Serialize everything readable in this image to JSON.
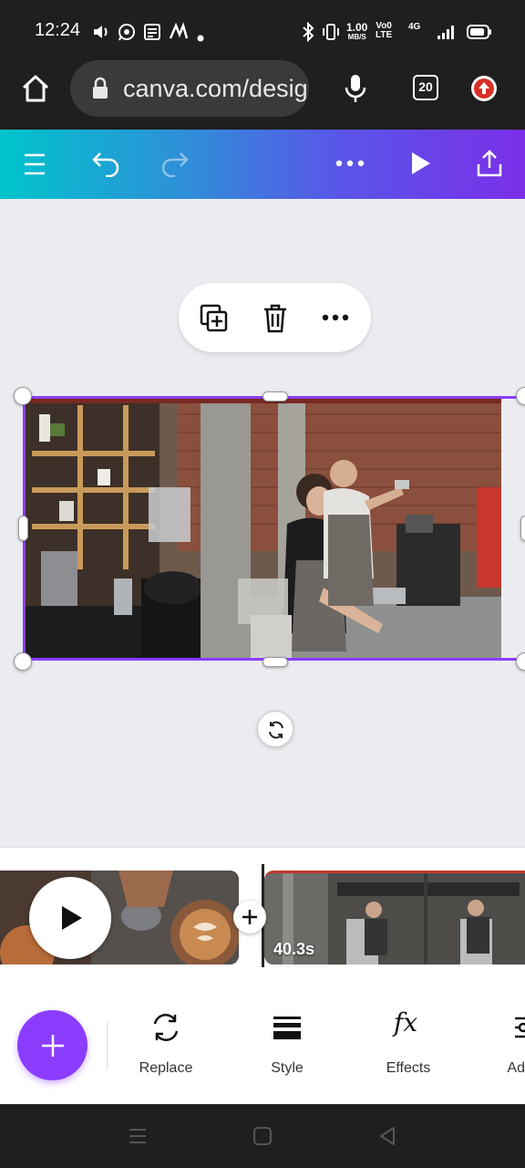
{
  "status_bar": {
    "time": "12:24",
    "net_speed_value": "1.00",
    "net_speed_unit": "MB/S",
    "volte_top": "Vo0",
    "volte_bottom": "LTE",
    "network_type": "4G"
  },
  "browser": {
    "url": "canva.com/design",
    "tab_count": "20"
  },
  "timeline": {
    "clip_duration": "40.3s"
  },
  "tools": [
    {
      "label": "Replace",
      "icon": "replace-icon"
    },
    {
      "label": "Style",
      "icon": "style-icon"
    },
    {
      "label": "Effects",
      "icon": "effects-icon"
    },
    {
      "label": "Ad",
      "icon": "adjust-icon"
    }
  ],
  "colors": {
    "accent": "#8b3dff",
    "gradient_start": "#00c4cc",
    "gradient_end": "#7b2fe8"
  }
}
